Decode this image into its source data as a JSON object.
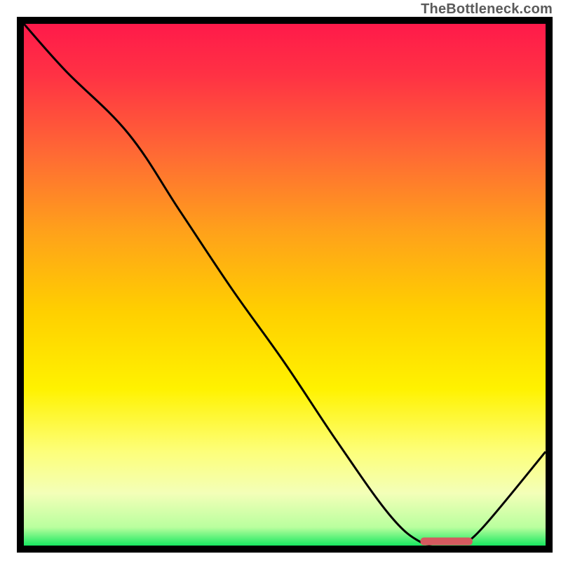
{
  "attribution": "TheBottleneck.com",
  "chart_data": {
    "type": "line",
    "title": "",
    "xlabel": "",
    "ylabel": "",
    "xlim": [
      0,
      100
    ],
    "ylim": [
      0,
      100
    ],
    "series": [
      {
        "name": "bottleneck-curve",
        "x": [
          0,
          8,
          20,
          30,
          40,
          50,
          60,
          70,
          76,
          80,
          84,
          88,
          100
        ],
        "y": [
          100,
          91,
          79,
          64,
          49,
          35,
          20,
          6,
          0.7,
          0.5,
          0.6,
          3.5,
          18
        ]
      }
    ],
    "marker": {
      "name": "optimal-range",
      "x_start": 76,
      "x_end": 86,
      "y": 0.8,
      "color": "#d55a5f"
    },
    "gradient_stops": [
      {
        "offset": 0.0,
        "color": "#ff1a4a"
      },
      {
        "offset": 0.1,
        "color": "#ff3244"
      },
      {
        "offset": 0.25,
        "color": "#ff6a34"
      },
      {
        "offset": 0.4,
        "color": "#ffa21a"
      },
      {
        "offset": 0.55,
        "color": "#ffcf00"
      },
      {
        "offset": 0.7,
        "color": "#fff200"
      },
      {
        "offset": 0.82,
        "color": "#fdff7a"
      },
      {
        "offset": 0.9,
        "color": "#f3ffb8"
      },
      {
        "offset": 0.965,
        "color": "#b9ff9e"
      },
      {
        "offset": 1.0,
        "color": "#18e860"
      }
    ]
  }
}
